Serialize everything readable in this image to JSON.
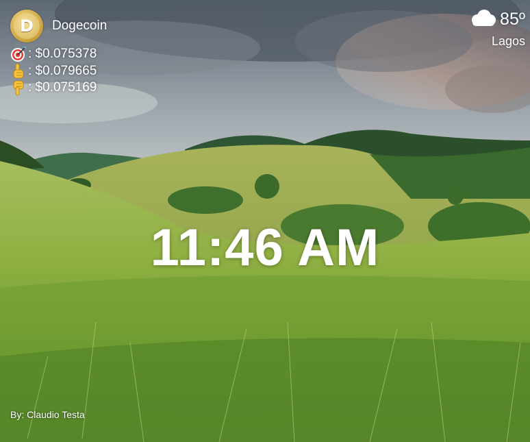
{
  "crypto": {
    "coin_name": "Dogecoin",
    "coin_symbol": "D",
    "prices": [
      {
        "icon": "target-icon",
        "label": ": $0.075378"
      },
      {
        "icon": "hand-up-icon",
        "label": ": $0.079665"
      },
      {
        "icon": "hand-down-icon",
        "label": ": $0.075169"
      }
    ]
  },
  "weather": {
    "icon": "cloud-icon",
    "temperature": "85º",
    "city": "Lagos"
  },
  "clock": {
    "time": "11:46 AM"
  },
  "credit": {
    "text": "By: Claudio Testa"
  },
  "colors": {
    "text": "#ffffff",
    "coin_gold": "#c9a23c",
    "grass": "#7fa83a"
  }
}
